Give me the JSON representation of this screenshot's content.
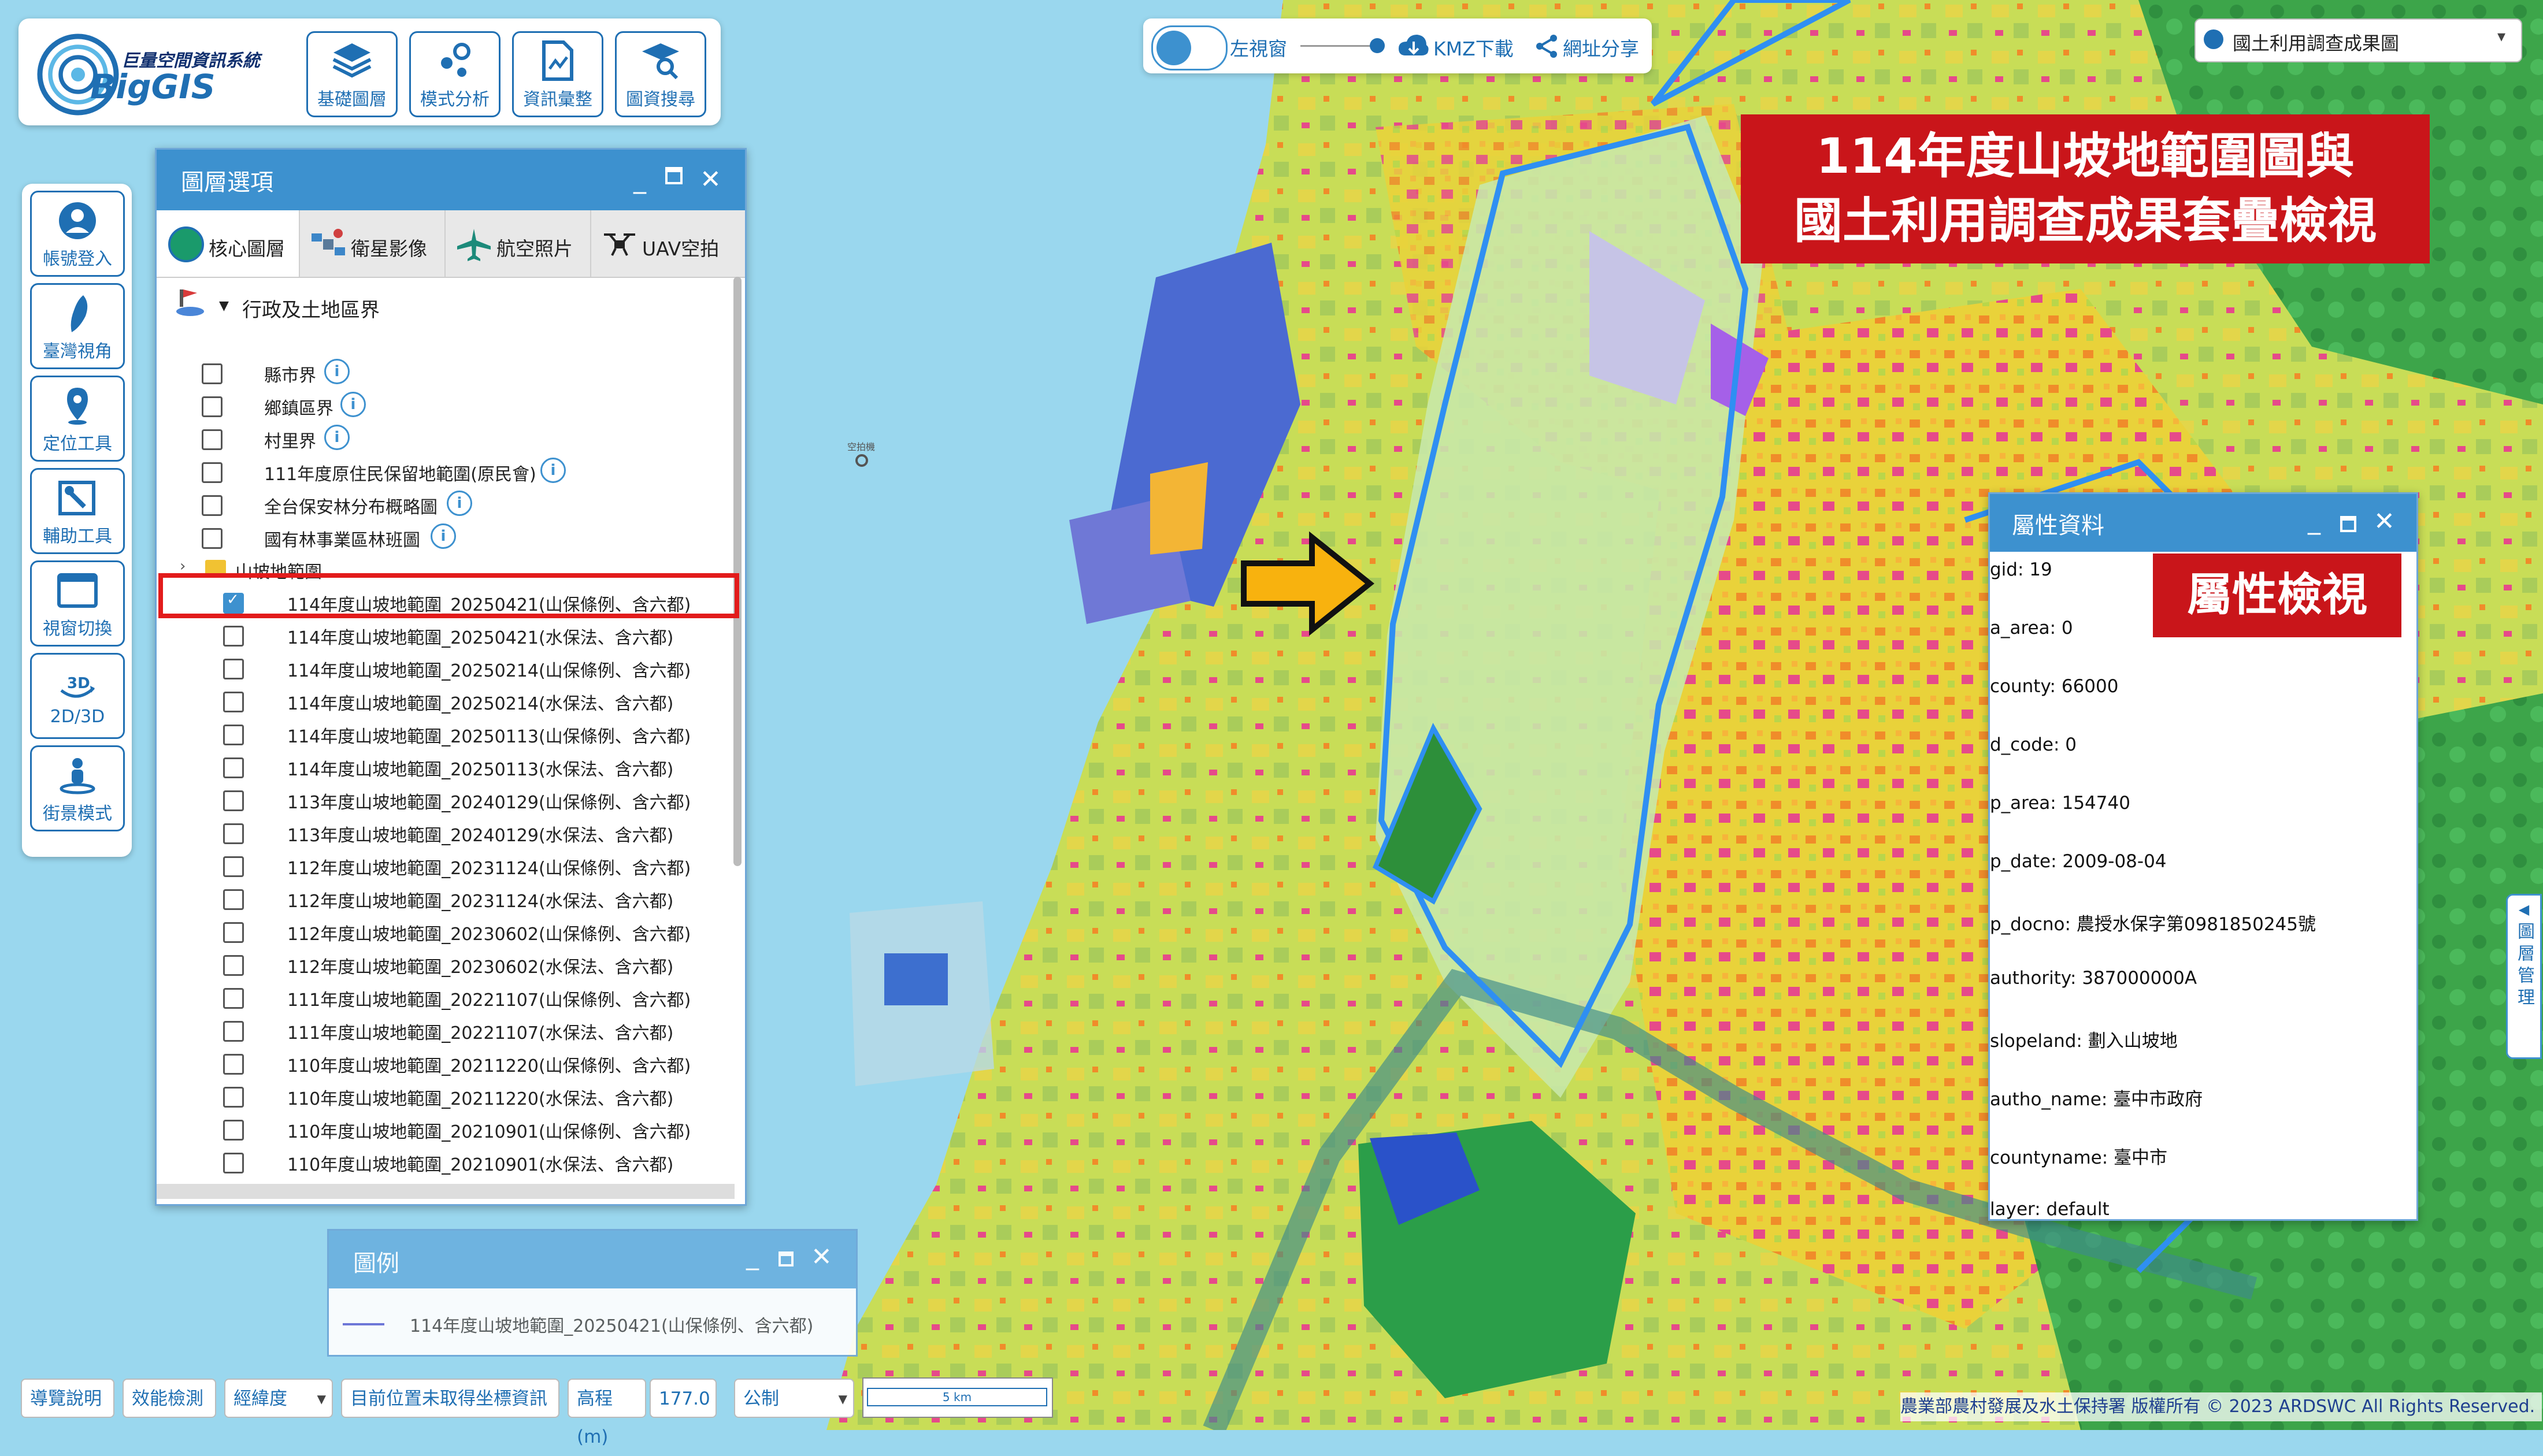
{
  "app": {
    "logo_subtitle": "巨量空間資訊系統",
    "logo_name": "BigGIS"
  },
  "toolbar": {
    "items": [
      {
        "label": "基礎圖層",
        "icon": "layers-icon"
      },
      {
        "label": "模式分析",
        "icon": "analysis-icon"
      },
      {
        "label": "資訊彙整",
        "icon": "info-summary-icon"
      },
      {
        "label": "圖資搜尋",
        "icon": "map-search-icon"
      }
    ]
  },
  "left_tools": {
    "items": [
      {
        "label": "帳號登入",
        "icon": "user-icon"
      },
      {
        "label": "臺灣視角",
        "icon": "taiwan-icon"
      },
      {
        "label": "定位工具",
        "icon": "location-pin-icon"
      },
      {
        "label": "輔助工具",
        "icon": "toolbox-icon"
      },
      {
        "label": "視窗切換",
        "icon": "window-icon"
      },
      {
        "label": "2D/3D",
        "icon": "3d-rotate-icon"
      },
      {
        "label": "街景模式",
        "icon": "street-view-icon"
      }
    ]
  },
  "top_controls": {
    "left_window_label": "左視窗",
    "kmz_label": "KMZ下載",
    "share_label": "網址分享"
  },
  "basemap": {
    "selected": "國土利用調查成果圖"
  },
  "banner": {
    "line1": "114年度山坡地範圍圖與",
    "line2": "國土利用調查成果套疊檢視"
  },
  "layer_panel": {
    "title": "圖層選項",
    "tabs": [
      {
        "label": "核心圖層",
        "icon": "core-layer-icon"
      },
      {
        "label": "衛星影像",
        "icon": "satellite-icon"
      },
      {
        "label": "航空照片",
        "icon": "airplane-icon"
      },
      {
        "label": "UAV空拍",
        "icon": "drone-icon"
      }
    ],
    "group_title": "行政及土地區界",
    "admin_layers": [
      "縣市界",
      "鄉鎮區界",
      "村里界",
      "111年度原住民保留地範圍(原民會)",
      "全台保安林分布概略圖",
      "國有林事業區林班圖"
    ],
    "subgroup": "山坡地範圍",
    "slope_layers": [
      {
        "label": "114年度山坡地範圍_20250421(山保條例、含六都)",
        "checked": true
      },
      {
        "label": "114年度山坡地範圍_20250421(水保法、含六都)",
        "checked": false
      },
      {
        "label": "114年度山坡地範圍_20250214(山保條例、含六都)",
        "checked": false
      },
      {
        "label": "114年度山坡地範圍_20250214(水保法、含六都)",
        "checked": false
      },
      {
        "label": "114年度山坡地範圍_20250113(山保條例、含六都)",
        "checked": false
      },
      {
        "label": "114年度山坡地範圍_20250113(水保法、含六都)",
        "checked": false
      },
      {
        "label": "113年度山坡地範圍_20240129(山保條例、含六都)",
        "checked": false
      },
      {
        "label": "113年度山坡地範圍_20240129(水保法、含六都)",
        "checked": false
      },
      {
        "label": "112年度山坡地範圍_20231124(山保條例、含六都)",
        "checked": false
      },
      {
        "label": "112年度山坡地範圍_20231124(水保法、含六都)",
        "checked": false
      },
      {
        "label": "112年度山坡地範圍_20230602(山保條例、含六都)",
        "checked": false
      },
      {
        "label": "112年度山坡地範圍_20230602(水保法、含六都)",
        "checked": false
      },
      {
        "label": "111年度山坡地範圍_20221107(山保條例、含六都)",
        "checked": false
      },
      {
        "label": "111年度山坡地範圍_20221107(水保法、含六都)",
        "checked": false
      },
      {
        "label": "110年度山坡地範圍_20211220(山保條例、含六都)",
        "checked": false
      },
      {
        "label": "110年度山坡地範圍_20211220(水保法、含六都)",
        "checked": false
      },
      {
        "label": "110年度山坡地範圍_20210901(山保條例、含六都)",
        "checked": false
      },
      {
        "label": "110年度山坡地範圍_20210901(水保法、含六都)",
        "checked": false
      }
    ]
  },
  "legend": {
    "title": "圖例",
    "item": "114年度山坡地範圍_20250421(山保條例、含六都)"
  },
  "attributes": {
    "title": "屬性資料",
    "badge": "屬性檢視",
    "rows": [
      "gid: 19",
      "a_area: 0",
      "county: 66000",
      "d_code: 0",
      "p_area: 154740",
      "p_date: 2009-08-04",
      "p_docno: 農授水保字第0981850245號",
      "authority: 387000000A",
      "slopeland: 劃入山坡地",
      "autho_name: 臺中市政府",
      "countyname: 臺中市",
      "layer: default"
    ]
  },
  "side_tab": "圖層管理",
  "bottom_bar": {
    "guide": "導覽說明",
    "performance": "效能檢測",
    "coord_select": "經緯度",
    "position": "目前位置未取得坐標資訊",
    "elevation_label": "高程(m)",
    "elevation_value": "177.0",
    "unit_select": "公制",
    "scale": "5 km"
  },
  "map_label": "空拍機",
  "copyright": "農業部農村發展及水土保持署 版權所有 © 2023 ARDSWC All Rights Reserved."
}
